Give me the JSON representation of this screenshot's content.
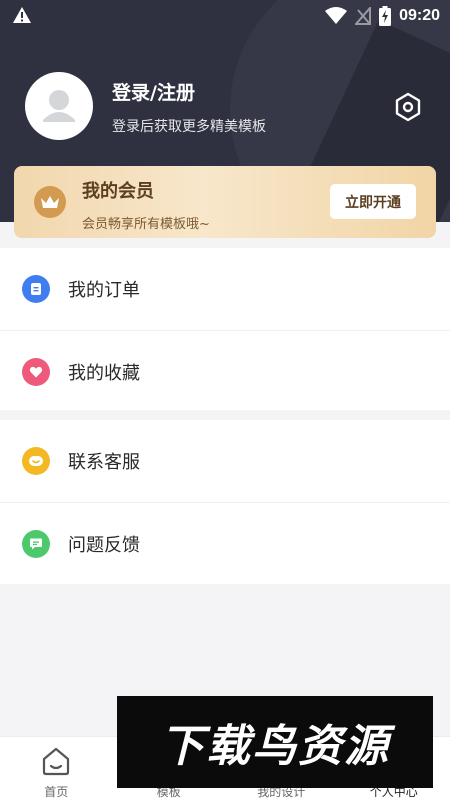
{
  "status_bar": {
    "time": "09:20"
  },
  "profile": {
    "login_title": "登录/注册",
    "login_subtitle": "登录后获取更多精美模板"
  },
  "vip": {
    "title": "我的会员",
    "subtitle": "会员畅享所有模板哦~",
    "button": "立即开通",
    "colors": {
      "card": "#f4dfbb",
      "badge": "#d39a52",
      "text": "#5b3f20"
    }
  },
  "menu_groups": [
    [
      {
        "label": "我的订单",
        "icon": "order-icon",
        "color": "#3f7df0"
      },
      {
        "label": "我的收藏",
        "icon": "favorite-heart-icon",
        "color": "#ee5a7c"
      }
    ],
    [
      {
        "label": "联系客服",
        "icon": "customer-service-icon",
        "color": "#f4b822"
      },
      {
        "label": "问题反馈",
        "icon": "feedback-icon",
        "color": "#4cc96a"
      }
    ]
  ],
  "tabbar": [
    {
      "label": "首页",
      "icon": "home-icon"
    },
    {
      "label": "模板",
      "icon": "template-icon"
    },
    {
      "label": "我的设计",
      "icon": "design-icon"
    },
    {
      "label": "个人中心",
      "icon": "profile-icon"
    }
  ],
  "watermark": {
    "text": "下载鸟资源"
  }
}
